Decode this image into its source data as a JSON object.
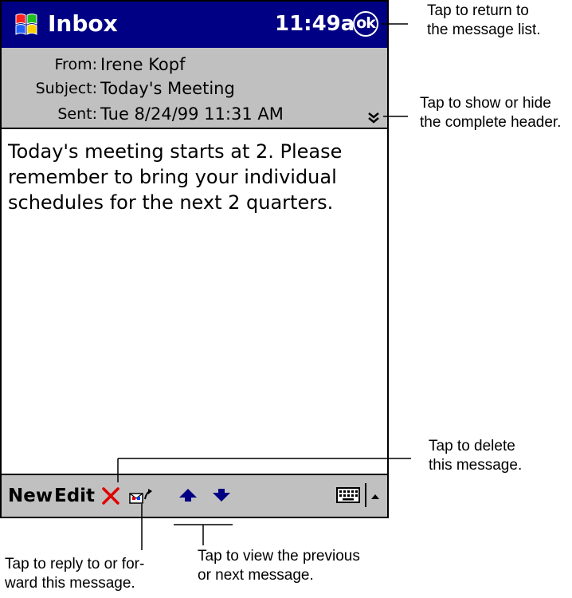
{
  "titlebar": {
    "app_title": "Inbox",
    "time": "11:49a",
    "ok_label": "ok",
    "app_icon": "windows-flag-icon"
  },
  "header": {
    "from_label": "From:",
    "from_value": "Irene Kopf",
    "subject_label": "Subject:",
    "subject_value": "Today's Meeting",
    "sent_label": "Sent:",
    "sent_value": "Tue 8/24/99 11:31 AM",
    "expand_icon": "double-chevron-down-icon"
  },
  "message": {
    "body": "Today's meeting starts at 2. Please\nremember to bring your individual\nschedules for the next 2 quarters."
  },
  "toolbar": {
    "new_label": "New",
    "edit_label": "Edit",
    "delete_icon": "delete-x-icon",
    "reply_icon": "reply-forward-icon",
    "previous_icon": "up-arrow-icon",
    "next_icon": "down-arrow-icon",
    "keyboard_icon": "keyboard-icon",
    "input_menu_icon": "input-menu-arrow-icon"
  },
  "callouts": {
    "ok": "Tap to return to\nthe message list.",
    "header": "Tap to show or hide\nthe complete header.",
    "delete": "Tap to delete\nthis message.",
    "reply": "Tap to reply to or for-\nward this message.",
    "navigate": "Tap to view the previous\nor next message."
  },
  "colors": {
    "titlebar": "#000084",
    "header_bg": "#c0c0c0",
    "delete_red": "#e00000",
    "arrow_blue": "#000084"
  }
}
